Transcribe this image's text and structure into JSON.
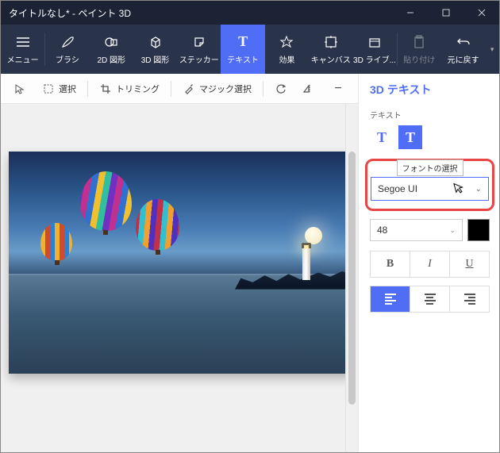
{
  "window": {
    "title": "タイトルなし* - ペイント 3D"
  },
  "ribbon": {
    "menu": "メニュー",
    "brush": "ブラシ",
    "shapes2d": "2D 図形",
    "shapes3d": "3D 図形",
    "stickers": "ステッカー",
    "text": "テキスト",
    "effects": "効果",
    "canvas": "キャンバス",
    "library3d": "3D ライブ...",
    "paste": "貼り付け",
    "undo": "元に戻す"
  },
  "subbar": {
    "select": "選択",
    "crop": "トリミング",
    "magic": "マジック選択"
  },
  "panel": {
    "title": "3D テキスト",
    "text_section": "テキスト",
    "font_tooltip": "フォントの選択",
    "font_value": "Segoe UI",
    "size_value": "48",
    "bold": "B",
    "italic": "I",
    "underline": "U"
  },
  "text_types": {
    "t2d": "T",
    "t3d": "T"
  }
}
